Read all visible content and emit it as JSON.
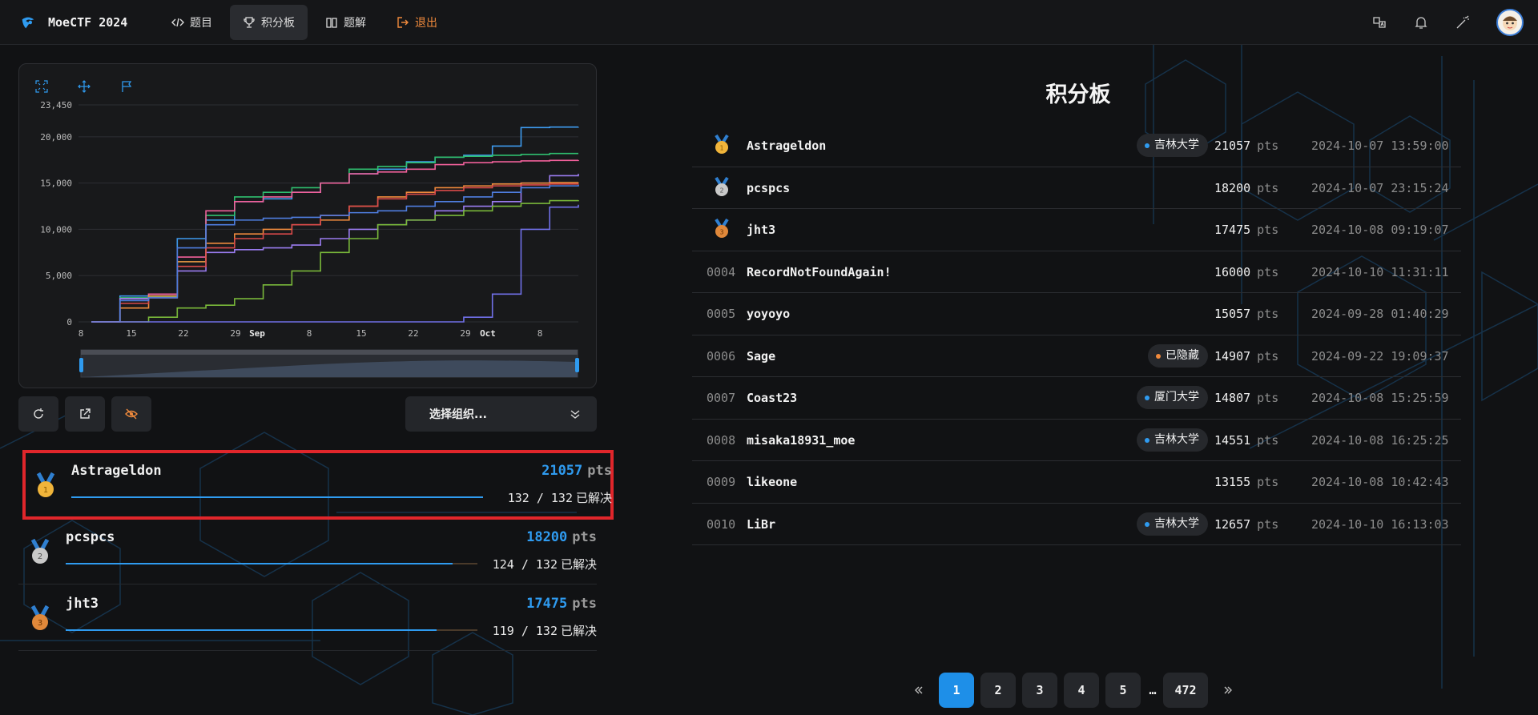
{
  "app": {
    "title": "MoeCTF 2024"
  },
  "nav": [
    {
      "label": "题目",
      "icon": "code-icon"
    },
    {
      "label": "积分板",
      "icon": "trophy-icon",
      "active": true
    },
    {
      "label": "题解",
      "icon": "book-icon"
    },
    {
      "label": "退出",
      "icon": "logout-icon"
    }
  ],
  "topright_icons": [
    "translate-icon",
    "bell-icon",
    "magic-wand-icon"
  ],
  "toolbar": {
    "org_select": "选择组织..."
  },
  "chart_data": {
    "type": "line",
    "title": "",
    "xlabel": "",
    "ylabel": "",
    "ylim": [
      0,
      23450
    ],
    "yticks": [
      "0",
      "5,000",
      "10,000",
      "15,000",
      "20,000",
      "23,450"
    ],
    "xticks": [
      "8",
      "15",
      "22",
      "29",
      "Sep",
      "8",
      "15",
      "22",
      "29",
      "Oct",
      "8"
    ],
    "x": [
      "Aug 8",
      "Aug 12",
      "Aug 16",
      "Aug 20",
      "Aug 24",
      "Aug 28",
      "Sep 1",
      "Sep 5",
      "Sep 9",
      "Sep 13",
      "Sep 17",
      "Sep 21",
      "Sep 25",
      "Sep 29",
      "Oct 3",
      "Oct 7",
      "Oct 11",
      "Oct 14"
    ],
    "series": [
      {
        "color": "#3e9bef",
        "values": [
          0,
          2800,
          3000,
          9000,
          11000,
          13000,
          13300,
          14000,
          15000,
          16000,
          16500,
          17300,
          17800,
          18000,
          19000,
          21000,
          21050,
          21057
        ]
      },
      {
        "color": "#2fbf6f",
        "values": [
          0,
          2600,
          2700,
          6500,
          11500,
          13500,
          14000,
          14500,
          15000,
          16500,
          16800,
          17200,
          17800,
          17900,
          18000,
          18100,
          18200,
          18200
        ]
      },
      {
        "color": "#f0609a",
        "values": [
          0,
          2500,
          3000,
          7000,
          12000,
          13000,
          13500,
          14000,
          15000,
          16000,
          16200,
          16500,
          17000,
          17200,
          17300,
          17400,
          17450,
          17475
        ]
      },
      {
        "color": "#9a7cf0",
        "values": [
          0,
          2500,
          2800,
          5500,
          7500,
          7800,
          8000,
          8300,
          9000,
          10000,
          10500,
          11000,
          12000,
          12500,
          13000,
          15000,
          15800,
          16000
        ]
      },
      {
        "color": "#f08a3c",
        "values": [
          0,
          1500,
          2800,
          6500,
          8500,
          9500,
          10000,
          10500,
          11000,
          12500,
          13500,
          14000,
          14500,
          14700,
          14900,
          15000,
          15050,
          15057
        ]
      },
      {
        "color": "#d94a4a",
        "values": [
          0,
          2000,
          2600,
          6000,
          8000,
          9000,
          9500,
          10500,
          11500,
          12500,
          13300,
          13800,
          14200,
          14500,
          14700,
          14800,
          14900,
          14907
        ]
      },
      {
        "color": "#4f7ee0",
        "values": [
          0,
          2300,
          2600,
          8000,
          10500,
          11000,
          11200,
          11300,
          11500,
          11800,
          12000,
          12500,
          13000,
          13500,
          14000,
          14500,
          14700,
          14807
        ]
      },
      {
        "color": "#79b83a",
        "values": [
          0,
          0,
          500,
          1500,
          1800,
          2500,
          4000,
          5500,
          7500,
          9000,
          10500,
          11000,
          11500,
          12000,
          12500,
          12800,
          13100,
          13155
        ]
      },
      {
        "color": "#7070e8",
        "values": [
          0,
          0,
          0,
          0,
          0,
          0,
          0,
          0,
          0,
          0,
          0,
          0,
          0,
          500,
          3000,
          10000,
          12400,
          12657
        ]
      }
    ]
  },
  "ranklist": [
    {
      "name": "Astrageldon",
      "pts": "21057",
      "unit": "pts",
      "solved": "132 / 132",
      "solved_label": "已解决",
      "progress": 1.0,
      "medal": "gold"
    },
    {
      "name": "pcspcs",
      "pts": "18200",
      "unit": "pts",
      "solved": "124 / 132",
      "solved_label": "已解决",
      "progress": 0.9394,
      "medal": "silver"
    },
    {
      "name": "jht3",
      "pts": "17475",
      "unit": "pts",
      "solved": "119 / 132",
      "solved_label": "已解决",
      "progress": 0.9015,
      "medal": "bronze"
    }
  ],
  "scoreboard": {
    "title": "积分板",
    "unit": "pts",
    "rows": [
      {
        "rank": "",
        "medal": "gold",
        "name": "Astrageldon",
        "org": "吉林大学",
        "org_dot": "#2f9bf0",
        "pts": "21057",
        "time": "2024-10-07 13:59:00"
      },
      {
        "rank": "",
        "medal": "silver",
        "name": "pcspcs",
        "org": "",
        "pts": "18200",
        "time": "2024-10-07 23:15:24"
      },
      {
        "rank": "",
        "medal": "bronze",
        "name": "jht3",
        "org": "",
        "pts": "17475",
        "time": "2024-10-08 09:19:07"
      },
      {
        "rank": "0004",
        "name": "RecordNotFoundAgain!",
        "org": "",
        "pts": "16000",
        "time": "2024-10-10 11:31:11"
      },
      {
        "rank": "0005",
        "name": "yoyoyo",
        "org": "",
        "pts": "15057",
        "time": "2024-09-28 01:40:29"
      },
      {
        "rank": "0006",
        "name": "Sage",
        "org": "已隐藏",
        "org_dot": "#f08a3c",
        "pts": "14907",
        "time": "2024-09-22 19:09:37"
      },
      {
        "rank": "0007",
        "name": "Coast23",
        "org": "厦门大学",
        "org_dot": "#2f9bf0",
        "pts": "14807",
        "time": "2024-10-08 15:25:59"
      },
      {
        "rank": "0008",
        "name": "misaka18931_moe",
        "org": "吉林大学",
        "org_dot": "#2f9bf0",
        "pts": "14551",
        "time": "2024-10-08 16:25:25"
      },
      {
        "rank": "0009",
        "name": "likeone",
        "org": "",
        "pts": "13155",
        "time": "2024-10-08 10:42:43"
      },
      {
        "rank": "0010",
        "name": "LiBr",
        "org": "吉林大学",
        "org_dot": "#2f9bf0",
        "pts": "12657",
        "time": "2024-10-10 16:13:03"
      }
    ]
  },
  "pagination": {
    "pages": [
      "1",
      "2",
      "3",
      "4",
      "5"
    ],
    "ellipsis": "…",
    "last": "472",
    "current": "1"
  }
}
